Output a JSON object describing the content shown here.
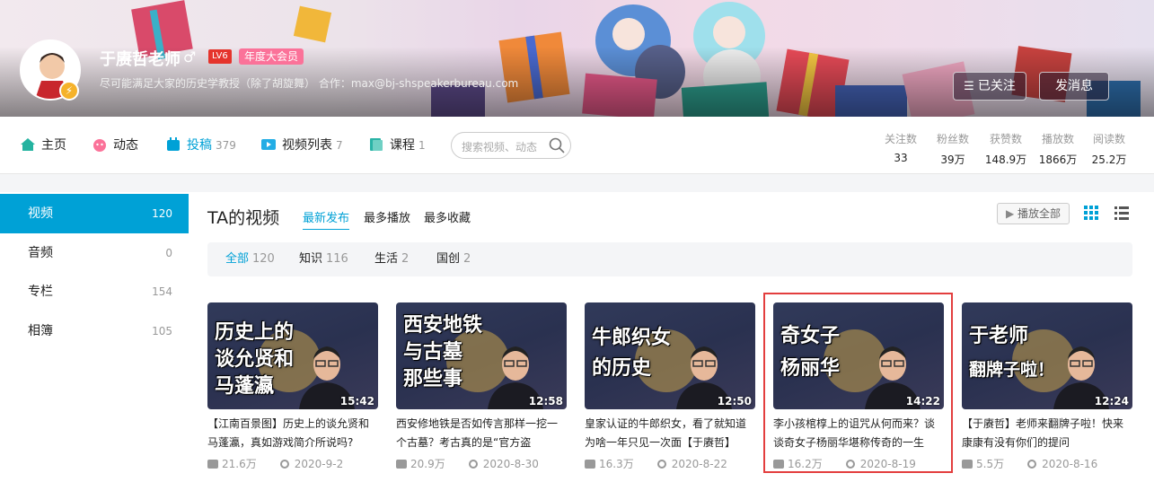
{
  "profile": {
    "name": "于赓哲老师",
    "level": "LV6",
    "vip": "年度大会员",
    "sign": "尽可能满足大家的历史学教授（除了胡旋舞） 合作：max@bj-shspeakerbureau.com",
    "follow_label": "已关注",
    "message_label": "发消息"
  },
  "nav": {
    "items": [
      {
        "label": "主页",
        "count": ""
      },
      {
        "label": "动态",
        "count": ""
      },
      {
        "label": "投稿",
        "count": "379"
      },
      {
        "label": "视频列表",
        "count": "7"
      },
      {
        "label": "课程",
        "count": "1"
      }
    ],
    "search_placeholder": "搜索视频、动态"
  },
  "stats": [
    {
      "key": "关注数",
      "value": "33"
    },
    {
      "key": "粉丝数",
      "value": "39万"
    },
    {
      "key": "获赞数",
      "value": "148.9万"
    },
    {
      "key": "播放数",
      "value": "1866万"
    },
    {
      "key": "阅读数",
      "value": "25.2万"
    }
  ],
  "sidebar": {
    "items": [
      {
        "label": "视频",
        "count": "120"
      },
      {
        "label": "音频",
        "count": "0"
      },
      {
        "label": "专栏",
        "count": "154"
      },
      {
        "label": "相簿",
        "count": "105"
      }
    ]
  },
  "main": {
    "title": "TA的视频",
    "sorts": [
      "最新发布",
      "最多播放",
      "最多收藏"
    ],
    "play_all": "播放全部",
    "filters": [
      {
        "label": "全部",
        "count": "120"
      },
      {
        "label": "知识",
        "count": "116"
      },
      {
        "label": "生活",
        "count": "2"
      },
      {
        "label": "国创",
        "count": "2"
      }
    ]
  },
  "videos": [
    {
      "caption": [
        "历史上的",
        "谈允贤和",
        "马蓬瀛"
      ],
      "duration": "15:42",
      "title": "【江南百景图】历史上的谈允贤和马蓬瀛，真如游戏简介所说吗?",
      "plays": "21.6万",
      "date": "2020-9-2"
    },
    {
      "caption": [
        "西安地铁",
        "与古墓",
        "那些事"
      ],
      "duration": "12:58",
      "title": "西安修地铁是否如传言那样一挖一个古墓？考古真的是“官方盗",
      "plays": "20.9万",
      "date": "2020-8-30"
    },
    {
      "caption": [
        "牛郎织女",
        "的历史"
      ],
      "duration": "12:50",
      "title": "皇家认证的牛郎织女，看了就知道为啥一年只见一次面【于赓哲】",
      "plays": "16.3万",
      "date": "2020-8-22"
    },
    {
      "caption": [
        "奇女子",
        "杨丽华"
      ],
      "duration": "14:22",
      "title": "李小孩棺椁上的诅咒从何而来？谈谈奇女子杨丽华堪称传奇的一生",
      "plays": "16.2万",
      "date": "2020-8-19"
    },
    {
      "caption": [
        "于老师",
        "翻牌子啦！"
      ],
      "duration": "12:24",
      "title": "【于赓哲】老师来翻牌子啦！快来康康有没有你们的提问",
      "plays": "5.5万",
      "date": "2020-8-16"
    }
  ],
  "colors": {
    "accent": "#00a1d6",
    "vip": "#fb7299",
    "highlight": "#e33e3e"
  }
}
